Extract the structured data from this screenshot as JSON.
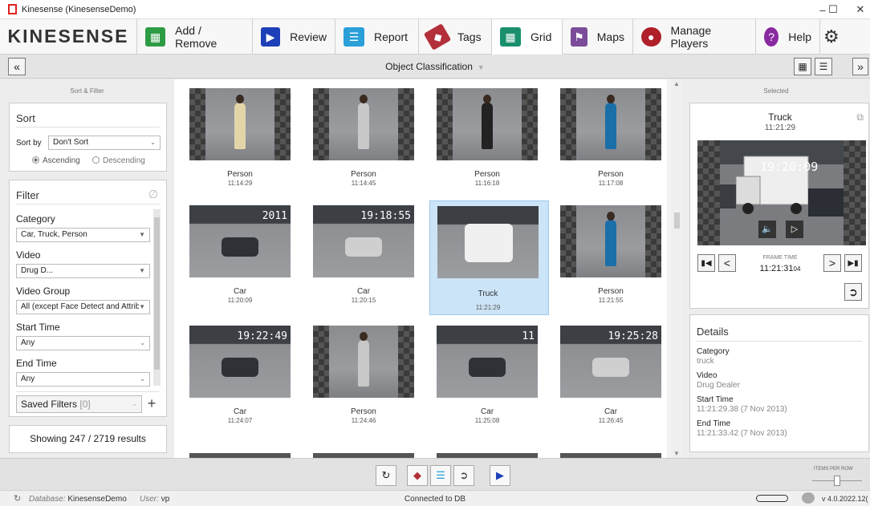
{
  "window": {
    "title": "Kinesense (KinesenseDemo)",
    "minimize": "–",
    "maximize": "☐",
    "close": "✕"
  },
  "toolbar": {
    "logo": "KINESENSE",
    "items": [
      {
        "label": "Add / Remove",
        "icon": "add-remove-icon",
        "color": "#2e9b45"
      },
      {
        "label": "Review",
        "icon": "review-icon",
        "color": "#1d3fb8"
      },
      {
        "label": "Report",
        "icon": "report-icon",
        "color": "#2a9fd8"
      },
      {
        "label": "Tags",
        "icon": "tags-icon",
        "color": "#b3303a"
      },
      {
        "label": "Grid",
        "icon": "grid-icon",
        "color": "#1a8f6d"
      },
      {
        "label": "Maps",
        "icon": "maps-icon",
        "color": "#7a4c9a"
      },
      {
        "label": "Manage Players",
        "icon": "manage-players-icon",
        "color": "#b0202a"
      },
      {
        "label": "Help",
        "icon": "help-icon",
        "color": "#8a2aa0"
      }
    ]
  },
  "subbar": {
    "collapse_left": "«",
    "title": "Object Classification",
    "collapse_right": "»"
  },
  "left": {
    "panel_title": "Sort & Filter",
    "sort": {
      "heading": "Sort",
      "sort_by_label": "Sort by",
      "sort_by_value": "Don't Sort",
      "asc": "Ascending",
      "desc": "Descending"
    },
    "filter": {
      "heading": "Filter",
      "category_label": "Category",
      "category_value": "Car, Truck, Person",
      "video_label": "Video",
      "video_value": "Drug D...",
      "video_group_label": "Video Group",
      "video_group_value": "All (except Face Detect and Attribu",
      "start_label": "Start Time",
      "start_value": "Any",
      "end_label": "End Time",
      "end_value": "Any",
      "saved_label": "Saved Filters",
      "saved_count": "[0]"
    },
    "results": "Showing 247 / 2719 results"
  },
  "grid": {
    "items": [
      {
        "type": "Person",
        "time": "11:14:29"
      },
      {
        "type": "Person",
        "time": "11:14:45"
      },
      {
        "type": "Person",
        "time": "11:16:18"
      },
      {
        "type": "Person",
        "time": "11:17:08"
      },
      {
        "type": "Car",
        "time": "11:20:09"
      },
      {
        "type": "Car",
        "time": "11:20:15"
      },
      {
        "type": "Truck",
        "time": "11:21:29"
      },
      {
        "type": "Person",
        "time": "11:21:55"
      },
      {
        "type": "Car",
        "time": "11:24:07"
      },
      {
        "type": "Person",
        "time": "11:24:46"
      },
      {
        "type": "Car",
        "time": "11:25:08"
      },
      {
        "type": "Car",
        "time": "11:26:45"
      }
    ],
    "overlays": [
      "2011",
      "19:18:55",
      "",
      "",
      "19:22:49",
      "",
      "11",
      "19:25:28"
    ]
  },
  "right": {
    "panel_title": "Selected",
    "selected_type": "Truck",
    "selected_time": "11:21:29",
    "video_overlay": "19:20:09",
    "frame_time_label": "FRAME TIME",
    "frame_time": "11:21:31",
    "frame_time_ms": "04",
    "details": {
      "heading": "Details",
      "category_label": "Category",
      "category_value": "truck",
      "video_label": "Video",
      "video_value": "Drug Dealer",
      "start_label": "Start Time",
      "start_value": "11:21:29.38 (7 Nov 2013)",
      "end_label": "End Time",
      "end_value": "11:21:33.42 (7 Nov 2013)"
    }
  },
  "bottom": {
    "items_per_row": "ITEMS PER ROW"
  },
  "status": {
    "db_label": "Database:",
    "db_value": "KinesenseDemo",
    "user_label": "User:",
    "user_value": "vp",
    "connection": "Connected to DB",
    "version": "v 4.0.2022.12("
  }
}
